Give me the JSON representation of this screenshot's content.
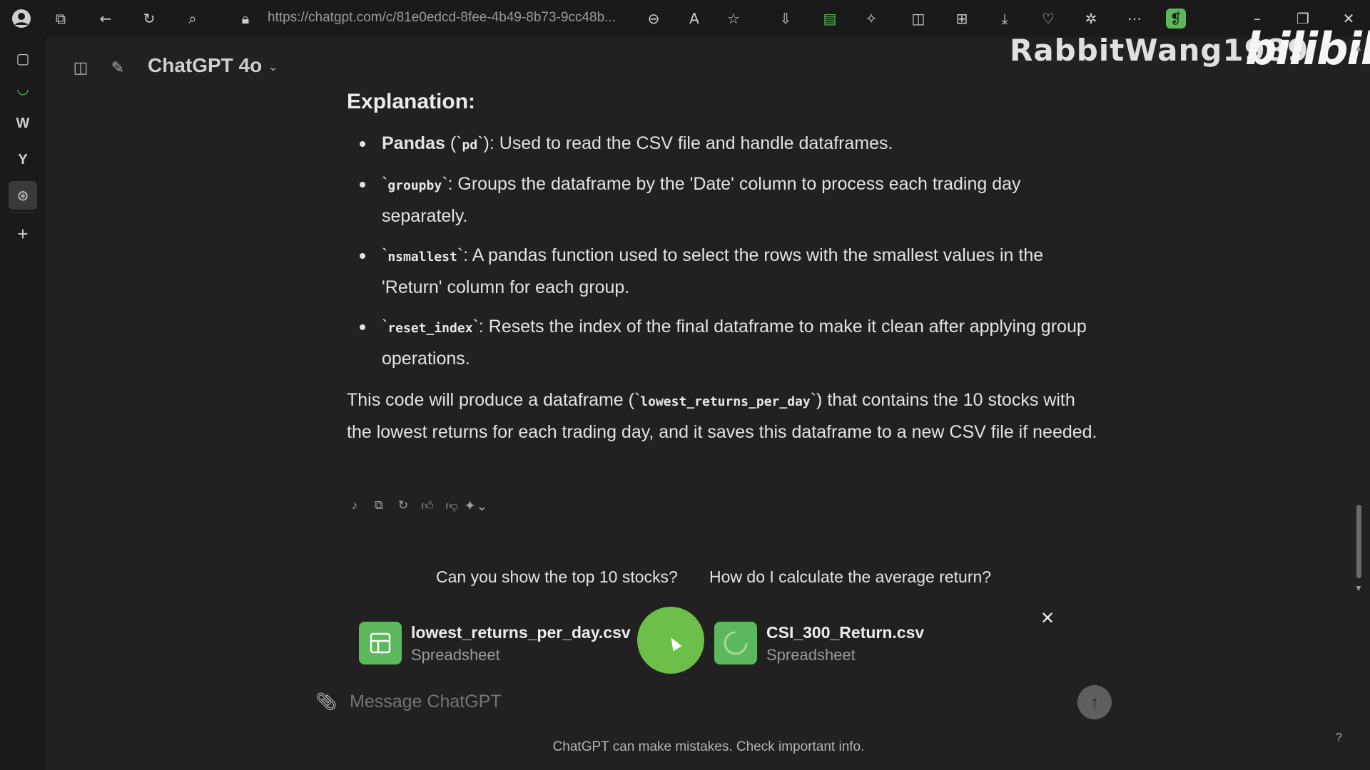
{
  "browser": {
    "url": "https://chatgpt.com/c/81e0edcd-8fee-4b49-8b73-9cc48b...",
    "icons": [
      "profile-icon",
      "tabs-icon",
      "back-icon",
      "reload-icon",
      "search-icon",
      "lock-icon",
      "zoom-out-icon",
      "read-aloud-icon",
      "favorite-icon",
      "download-icon",
      "printer-icon",
      "extensions-icon",
      "split-screen-icon",
      "collections-icon",
      "downloads-icon",
      "performance-icon",
      "copilot-icon",
      "more-icon",
      "extension-leaf-icon",
      "minimize-icon",
      "restore-icon",
      "close-icon"
    ]
  },
  "watermark": {
    "name": "RabbitWang1989",
    "logo": "bilibili"
  },
  "rail": {
    "icons": [
      "sidebar-pages-icon",
      "edge-loading-icon",
      "w-app-icon",
      "y-app-icon",
      "chatgpt-app-icon",
      "add-icon"
    ]
  },
  "header": {
    "model": "ChatGPT 4o"
  },
  "message": {
    "heading": "Explanation:",
    "bullets": [
      {
        "bold": "Pandas",
        "pre": " (`",
        "code": "pd",
        "post": "`): Used to read the CSV file and handle dataframes."
      },
      {
        "bold": "",
        "pre": "`",
        "code": "groupby",
        "post": "`: Groups the dataframe by the 'Date' column to process each trading day separately."
      },
      {
        "bold": "",
        "pre": "`",
        "code": "nsmallest",
        "post": "`: A pandas function used to select the rows with the smallest values in the 'Return' column for each group."
      },
      {
        "bold": "",
        "pre": "`",
        "code": "reset_index",
        "post": "`: Resets the index of the final dataframe to make it clean after applying group operations."
      }
    ],
    "paragraph": {
      "pre": "This code will produce a dataframe (`",
      "code": "lowest_returns_per_day",
      "post": "`) that contains the 10 stocks with the lowest returns for each trading day, and it saves this dataframe to a new CSV file if needed."
    },
    "actions": [
      "voice-icon",
      "copy-icon",
      "regenerate-icon",
      "thumbs-up-icon",
      "thumbs-down-icon",
      "sparkle-icon"
    ]
  },
  "suggestions": [
    "Can you show the top 10 stocks?",
    "How do I calculate the average return?"
  ],
  "attachments": [
    {
      "name": "lowest_returns_per_day.csv",
      "type": "Spreadsheet"
    },
    {
      "name": "CSI_300_Return.csv",
      "type": "Spreadsheet"
    }
  ],
  "composer": {
    "placeholder": "Message ChatGPT"
  },
  "footer": {
    "disclaimer": "ChatGPT can make mistakes. Check important info.",
    "help": "?"
  }
}
